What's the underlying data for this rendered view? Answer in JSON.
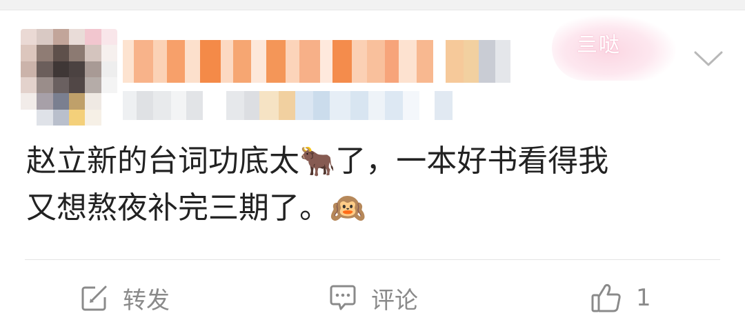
{
  "post": {
    "username": "",
    "badge_text": "亖哒",
    "line1_text": "赵立新的台词功底太",
    "line1_emoji": "🐂",
    "line1_rest": "了，一本好书看得我",
    "line2_text": "又想熬夜补完三期了。",
    "line2_emoji": "🙉"
  },
  "actions": {
    "repost_label": "转发",
    "comment_label": "评论",
    "like_count": "1"
  },
  "icons": {
    "repost": "edit-square-icon",
    "comment": "comment-bubble-icon",
    "like": "thumbs-up-icon",
    "menu": "chevron-down-icon"
  },
  "colors": {
    "text": "#222222",
    "action_gray": "#8a8a8a",
    "accent_orange": "#f07a2a"
  }
}
